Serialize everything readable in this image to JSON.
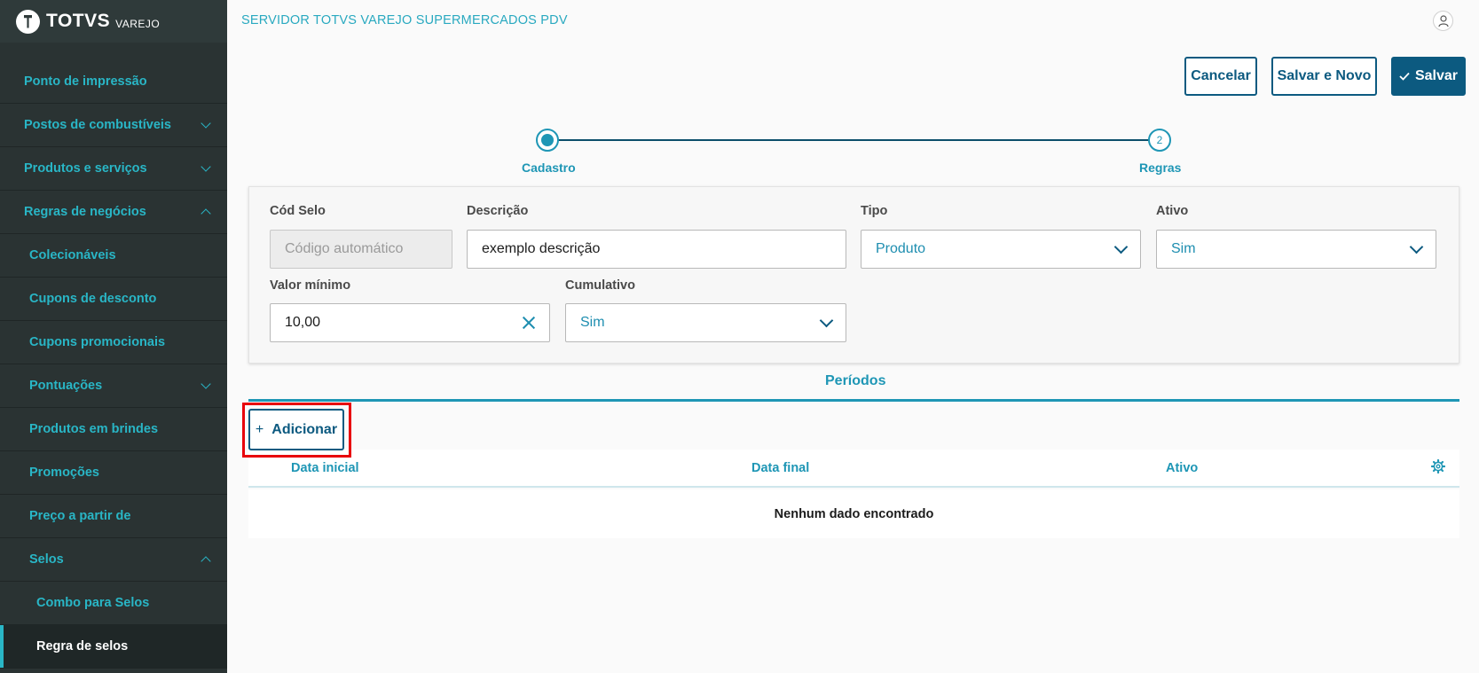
{
  "brand": {
    "name": "TOTVS",
    "sub": "VAREJO"
  },
  "sidebar": {
    "items": [
      {
        "label": "Ponto de impressão"
      },
      {
        "label": "Postos de combustíveis"
      },
      {
        "label": "Produtos e serviços"
      },
      {
        "label": "Regras de negócios"
      },
      {
        "label": "Colecionáveis"
      },
      {
        "label": "Cupons de desconto"
      },
      {
        "label": "Cupons promocionais"
      },
      {
        "label": "Pontuações"
      },
      {
        "label": "Produtos em brindes"
      },
      {
        "label": "Promoções"
      },
      {
        "label": "Preço a partir de"
      },
      {
        "label": "Selos"
      },
      {
        "label": "Combo para Selos"
      },
      {
        "label": "Regra de selos"
      }
    ]
  },
  "header": {
    "title": "SERVIDOR TOTVS VAREJO SUPERMERCADOS PDV"
  },
  "actions": {
    "cancel": "Cancelar",
    "save_new": "Salvar e Novo",
    "save": "Salvar"
  },
  "stepper": {
    "steps": [
      {
        "label": "Cadastro",
        "number": ""
      },
      {
        "label": "Regras",
        "number": "2"
      }
    ]
  },
  "form": {
    "cod_selo": {
      "label": "Cód Selo",
      "placeholder": "Código automático"
    },
    "descricao": {
      "label": "Descrição",
      "value": "exemplo descrição"
    },
    "tipo": {
      "label": "Tipo",
      "value": "Produto"
    },
    "ativo": {
      "label": "Ativo",
      "value": "Sim"
    },
    "valor_minimo": {
      "label": "Valor mínimo",
      "value": "10,00"
    },
    "cumulativo": {
      "label": "Cumulativo",
      "value": "Sim"
    }
  },
  "periodos": {
    "tab_label": "Períodos",
    "add_label": "Adicionar",
    "columns": [
      "Data inicial",
      "Data final",
      "Ativo"
    ],
    "empty_text": "Nenhum dado encontrado"
  },
  "colors": {
    "accent": "#29b6c6",
    "primary": "#0c5a80",
    "highlight": "#e8000b",
    "sidebar": "#2a3333"
  }
}
